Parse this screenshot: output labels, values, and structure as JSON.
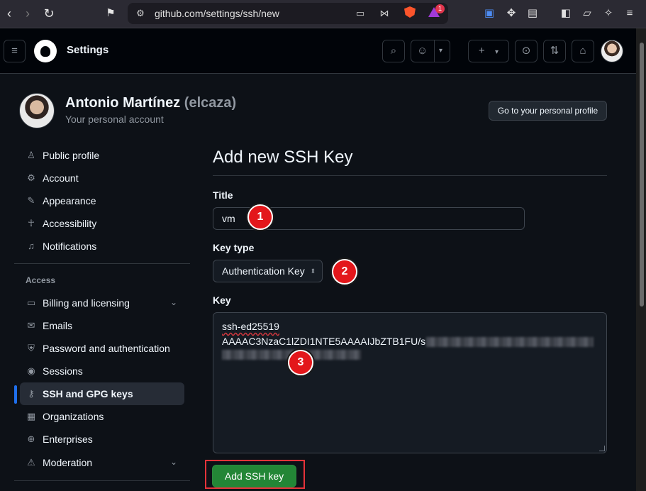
{
  "browser": {
    "url": "github.com/settings/ssh/new",
    "rewards_badge": "1"
  },
  "header": {
    "title": "Settings"
  },
  "account": {
    "name": "Antonio Martínez",
    "handle": "(elcaza)",
    "subtitle": "Your personal account",
    "profile_button": "Go to your personal profile"
  },
  "sidebar": {
    "items": [
      {
        "label": "Public profile",
        "icon": "person-icon"
      },
      {
        "label": "Account",
        "icon": "gear-icon"
      },
      {
        "label": "Appearance",
        "icon": "paintbrush-icon"
      },
      {
        "label": "Accessibility",
        "icon": "accessibility-icon"
      },
      {
        "label": "Notifications",
        "icon": "bell-icon"
      }
    ],
    "access_heading": "Access",
    "access_items": [
      {
        "label": "Billing and licensing",
        "icon": "credit-card-icon"
      },
      {
        "label": "Emails",
        "icon": "mail-icon"
      },
      {
        "label": "Password and authentication",
        "icon": "shield-lock-icon"
      },
      {
        "label": "Sessions",
        "icon": "broadcast-icon"
      },
      {
        "label": "SSH and GPG keys",
        "icon": "key-icon"
      },
      {
        "label": "Organizations",
        "icon": "organization-icon"
      },
      {
        "label": "Enterprises",
        "icon": "globe-icon"
      },
      {
        "label": "Moderation",
        "icon": "report-icon"
      }
    ]
  },
  "form": {
    "heading": "Add new SSH Key",
    "title_label": "Title",
    "title_value": "vm",
    "keytype_label": "Key type",
    "keytype_value": "Authentication Key",
    "key_label": "Key",
    "key_line1": "ssh-ed25519",
    "key_line2": "AAAAC3NzaC1lZDI1NTE5AAAAIJbZTB1FU/s",
    "submit_label": "Add SSH key"
  },
  "annotations": {
    "step1": "1",
    "step2": "2",
    "step3": "3"
  },
  "colors": {
    "accent": "#1f6feb",
    "primary_button": "#238636",
    "highlight_frame": "#e5333a",
    "step_marker": "#e3171b"
  }
}
